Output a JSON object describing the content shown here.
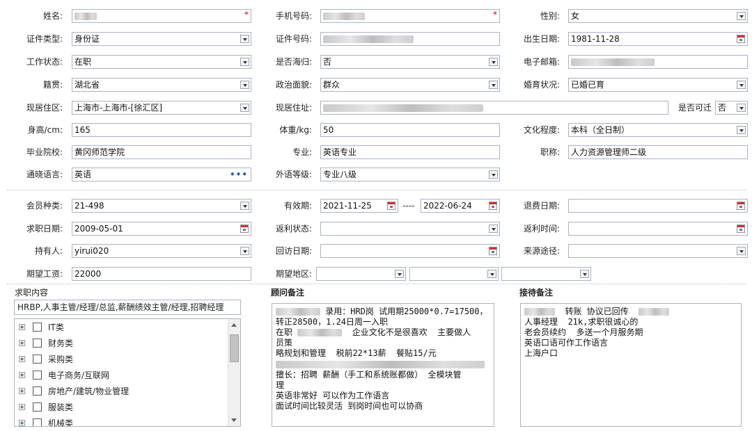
{
  "basic": {
    "name_label": "姓名:",
    "phone_label": "手机号码:",
    "gender_label": "性别:",
    "gender_value": "女",
    "id_type_label": "证件类型:",
    "id_type_value": "身份证",
    "id_no_label": "证件号码:",
    "birth_label": "出生日期:",
    "birth_value": "1981-11-28",
    "work_status_label": "工作状态:",
    "work_status_value": "在职",
    "overseas_label": "是否海归:",
    "overseas_value": "否",
    "email_label": "电子邮箱:",
    "native_label": "籍贯:",
    "native_value": "湖北省",
    "political_label": "政治面貌:",
    "political_value": "群众",
    "marital_label": "婚育状况:",
    "marital_value": "已婚已育",
    "residence_label": "现居住区:",
    "residence_value": "上海市-上海市-[徐汇区]",
    "address_label": "现居住址:",
    "relocate_label": "是否可迁",
    "relocate_value": "否",
    "height_label": "身高/cm:",
    "height_value": "165",
    "weight_label": "体重/kg:",
    "weight_value": "50",
    "education_label": "文化程度:",
    "education_value": "本科（全日制）",
    "school_label": "毕业院校:",
    "school_value": "黄冈师范学院",
    "major_label": "专业:",
    "major_value": "英语专业",
    "title_label": "职称:",
    "title_value": "人力资源管理师二级",
    "language_label": "通晓语言:",
    "language_value": "英语",
    "lang_level_label": "外语等级:",
    "lang_level_value": "专业八级",
    "language_more_icon": "•••"
  },
  "member": {
    "type_label": "会员种类:",
    "type_value": "21-498",
    "valid_label": "有效期:",
    "valid_from": "2021-11-25",
    "valid_sep": "----",
    "valid_to": "2022-06-24",
    "refund_date_label": "退费日期:",
    "job_date_label": "求职日期:",
    "job_date_value": "2009-05-01",
    "rebate_status_label": "返利状态:",
    "rebate_time_label": "返利时间:",
    "holder_label": "持有人:",
    "holder_value": "yirui020",
    "visit_date_label": "回访日期:",
    "source_label": "来源途径:",
    "salary_label": "期望工资:",
    "salary_value": "22000",
    "region_label": "期望地区:"
  },
  "job": {
    "section_label": "求职内容",
    "summary": "HRBP,人事主管/经理/总监,薪酬绩效主管/经理,招聘经理",
    "tree": [
      "IT类",
      "财务类",
      "采购类",
      "电子商务/互联网",
      "房地产/建筑/物业管理",
      "服装类",
      "机械类"
    ]
  },
  "consultant": {
    "title": "顾问备注",
    "l1": "录用：HRD岗 试用期25000*0.7=17500，",
    "l2": "转正28500，1.24日周一入职",
    "l3a": "在职",
    "l3b": "企业文化不是很喜欢  主要做人",
    "l4": "员策",
    "l5": "略规划和管理  税前22*13薪  餐贴15/元",
    "l7": "擅长：招聘 薪酬（手工和系统账都做） 全模块管",
    "l8": "理",
    "l9": "英语非常好 可以作为工作语言",
    "l10": "面试时间比较灵活 到岗时间也可以协商"
  },
  "reception": {
    "title": "接待备注",
    "l1a": "转账 协议已回传",
    "l2": "人事经理  21k,求职很诚心的",
    "l3": "老会员续约  多送一个月服务期",
    "l4": "英语口语可作工作语言",
    "l5": "上海户口"
  }
}
